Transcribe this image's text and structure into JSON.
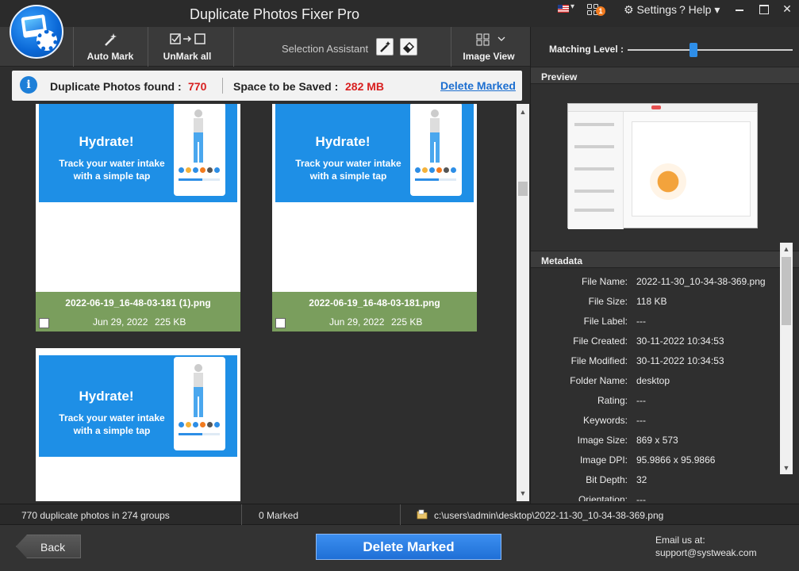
{
  "window": {
    "title": "Duplicate Photos Fixer Pro",
    "settings_label": "⚙ Settings",
    "help_label": "? Help ▾",
    "notif_count": "1"
  },
  "toolbar": {
    "auto_mark_label": "Auto Mark",
    "unmark_all_label": "UnMark all",
    "selection_assistant_label": "Selection Assistant",
    "image_view_label": "Image View"
  },
  "summary": {
    "duplicates_label": "Duplicate Photos found :",
    "duplicates_value": "770",
    "space_label": "Space to be Saved :",
    "space_value": "282 MB",
    "delete_marked_link": "Delete Marked"
  },
  "matching_level": {
    "label": "Matching Level :",
    "value_fraction": 0.4
  },
  "preview": {
    "header": "Preview"
  },
  "metadata": {
    "header": "Metadata",
    "rows": [
      {
        "key": "File Name:",
        "value": "2022-11-30_10-34-38-369.png"
      },
      {
        "key": "File Size:",
        "value": "118 KB"
      },
      {
        "key": "File Label:",
        "value": "---"
      },
      {
        "key": "File Created:",
        "value": "30-11-2022 10:34:53"
      },
      {
        "key": "File Modified:",
        "value": "30-11-2022 10:34:53"
      },
      {
        "key": "Folder Name:",
        "value": "desktop"
      },
      {
        "key": "Rating:",
        "value": "---"
      },
      {
        "key": "Keywords:",
        "value": "---"
      },
      {
        "key": "Image Size:",
        "value": "869 x 573"
      },
      {
        "key": "Image DPI:",
        "value": "95.9866 x 95.9866"
      },
      {
        "key": "Bit Depth:",
        "value": "32"
      },
      {
        "key": "Orientation:",
        "value": "---"
      }
    ]
  },
  "photo_ad": {
    "headline": "Hydrate!",
    "sub_line1": "Track your water intake",
    "sub_line2": "with a simple tap"
  },
  "photos": [
    {
      "name": "2022-06-19_16-48-03-181 (1).png",
      "date": "Jun 29, 2022",
      "size": "225 KB",
      "checked": false
    },
    {
      "name": "2022-06-19_16-48-03-181.png",
      "date": "Jun 29, 2022",
      "size": "225 KB",
      "checked": false
    }
  ],
  "status": {
    "groups_text": "770 duplicate photos in 274 groups",
    "marked_text": "0 Marked",
    "path_text": "c:\\users\\admin\\desktop\\2022-11-30_10-34-38-369.png"
  },
  "footer": {
    "back_label": "Back",
    "delete_marked_label": "Delete Marked",
    "email_label": "Email us at:",
    "email_value": "support@systweak.com"
  },
  "colors": {
    "accent_blue": "#2e8ee8",
    "count_red": "#d81f1f",
    "group_green": "#7a9e5d"
  }
}
